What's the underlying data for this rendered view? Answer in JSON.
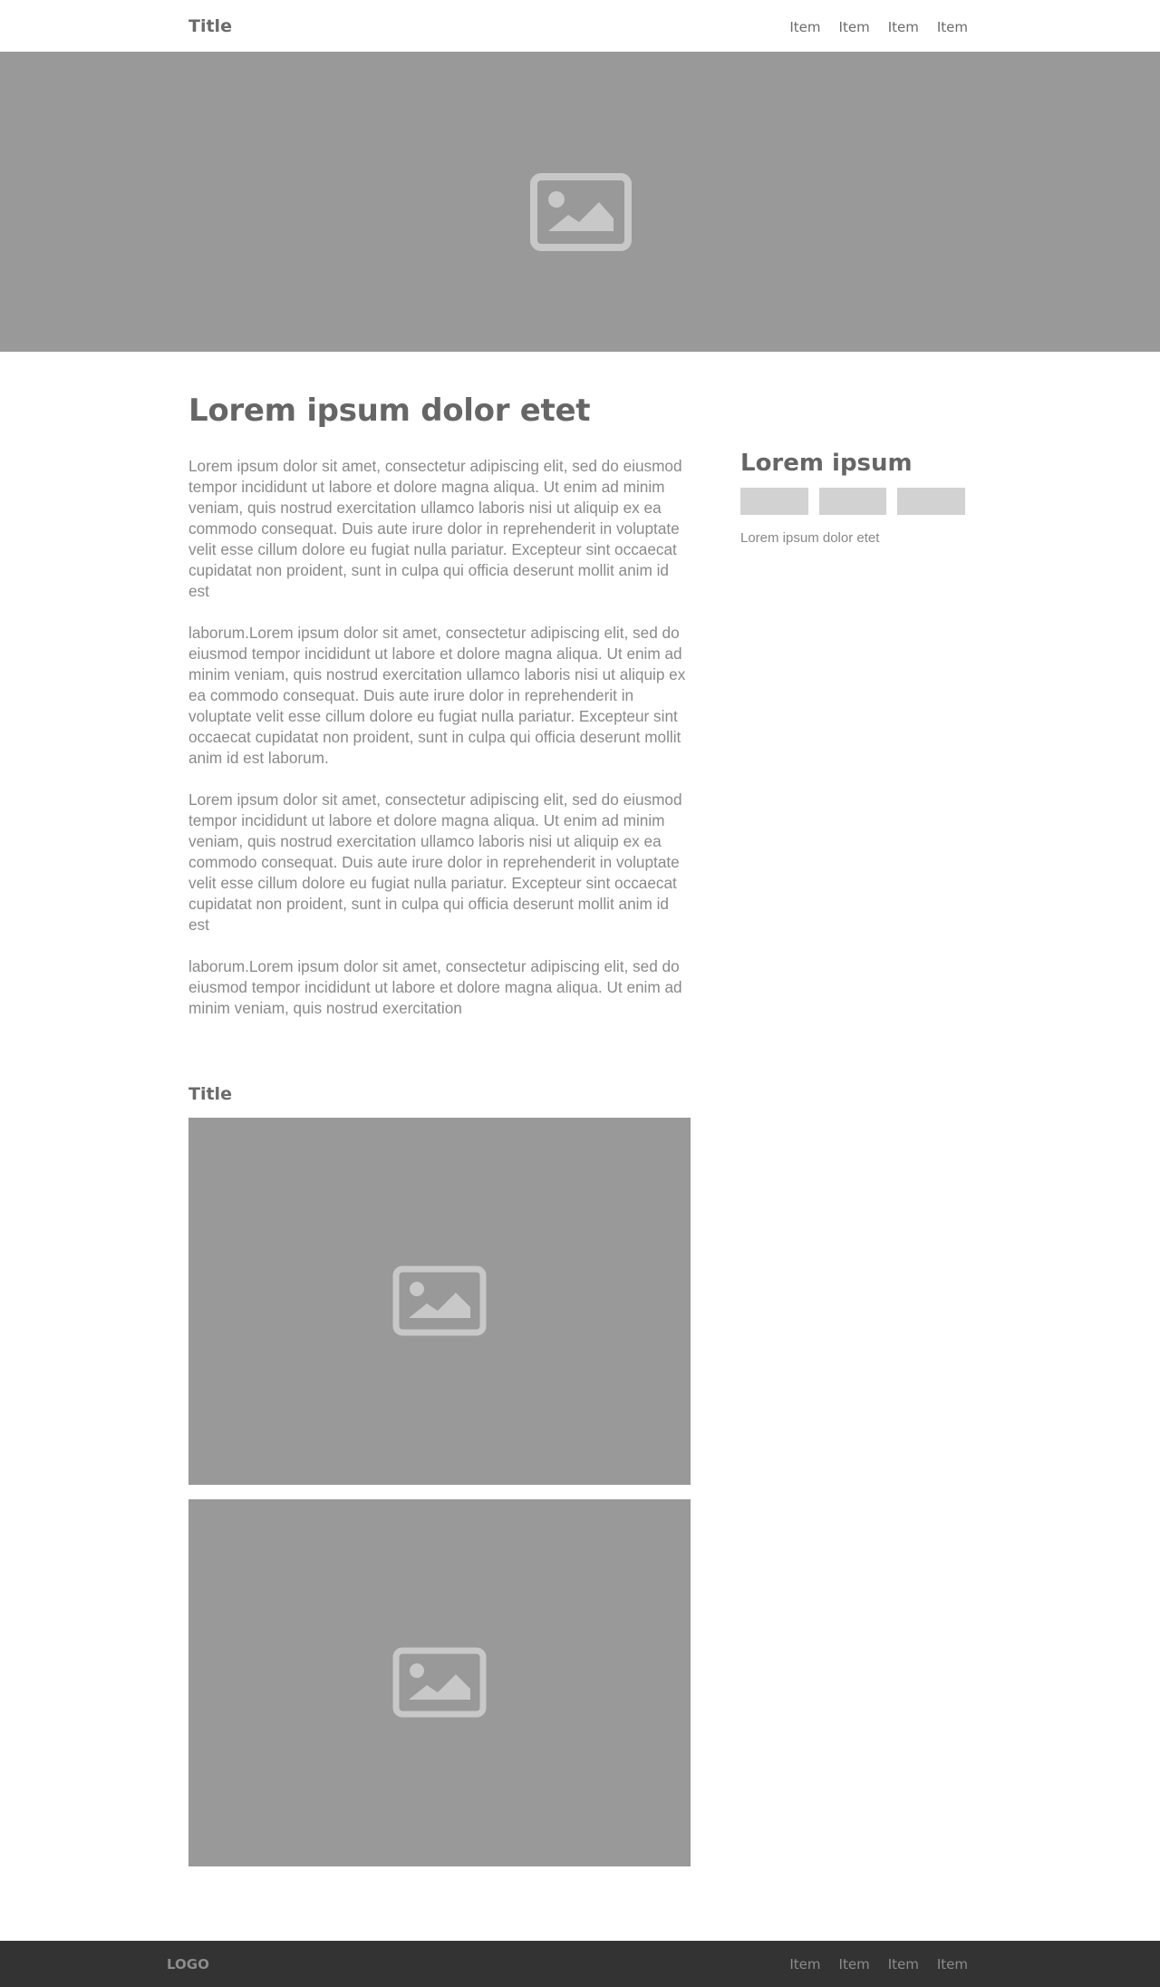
{
  "header": {
    "title": "Title",
    "nav": [
      "Item",
      "Item",
      "Item",
      "Item"
    ]
  },
  "hero": {
    "icon": "image-placeholder-icon"
  },
  "main": {
    "heading": "Lorem ipsum dolor etet",
    "paragraphs": [
      "Lorem ipsum dolor sit amet, consectetur adipiscing elit, sed do eiusmod tempor incididunt ut labore et dolore magna aliqua. Ut enim ad minim veniam, quis nostrud exercitation ullamco laboris nisi ut aliquip ex ea commodo consequat. Duis aute irure dolor in reprehenderit in voluptate velit esse cillum dolore eu fugiat nulla pariatur. Excepteur sint occaecat cupidatat non proident, sunt in culpa qui officia deserunt mollit anim id est",
      "laborum.Lorem ipsum dolor sit amet, consectetur adipiscing elit, sed do eiusmod tempor incididunt ut labore et dolore magna aliqua. Ut enim ad minim veniam, quis nostrud exercitation ullamco laboris nisi ut aliquip ex ea commodo consequat. Duis aute irure dolor in reprehenderit in voluptate velit esse cillum dolore eu fugiat nulla pariatur. Excepteur sint occaecat cupidatat non proident, sunt in culpa qui officia deserunt mollit anim id est laborum.",
      "Lorem ipsum dolor sit amet, consectetur adipiscing elit, sed do eiusmod tempor incididunt ut labore et dolore magna aliqua. Ut enim ad minim veniam, quis nostrud exercitation ullamco laboris nisi ut aliquip ex ea commodo consequat. Duis aute irure dolor in reprehenderit in voluptate velit esse cillum dolore eu fugiat nulla pariatur. Excepteur sint occaecat cupidatat non proident, sunt in culpa qui officia deserunt mollit anim id est",
      "laborum.Lorem ipsum dolor sit amet, consectetur adipiscing elit, sed do eiusmod tempor incididunt ut labore et dolore magna aliqua. Ut enim ad minim veniam, quis nostrud exercitation"
    ],
    "gallery_title": "Title"
  },
  "sidebar": {
    "heading": "Lorem ipsum",
    "caption": "Lorem ipsum dolor etet"
  },
  "footer": {
    "logo": "LOGO",
    "nav": [
      "Item",
      "Item",
      "Item",
      "Item"
    ]
  },
  "colors": {
    "placeholder": "#999999",
    "placeholder_icon": "#c8c8c8",
    "tag": "#d2d2d2",
    "footer_bg": "#333333"
  }
}
